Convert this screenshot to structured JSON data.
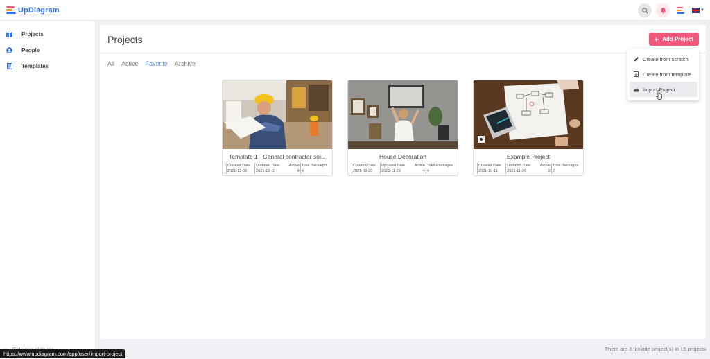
{
  "app": {
    "logo_text": "UpDiagram"
  },
  "header": {
    "icons": [
      "search-icon",
      "bell-icon",
      "menu-lines-icon",
      "uk-flag-icon"
    ]
  },
  "sidebar": {
    "items": [
      {
        "label": "Projects",
        "icon": "book-icon"
      },
      {
        "label": "People",
        "icon": "person-icon"
      },
      {
        "label": "Templates",
        "icon": "template-icon"
      }
    ],
    "collapse_label": "Collapse sidebar"
  },
  "main": {
    "title": "Projects",
    "add_button_label": "Add Project",
    "tabs": [
      {
        "label": "All",
        "active": false
      },
      {
        "label": "Active",
        "active": false
      },
      {
        "label": "Favorite",
        "active": true
      },
      {
        "label": "Archive",
        "active": false
      }
    ],
    "meta_headers": [
      "Created Date",
      "Updated Date",
      "Active",
      "Total Packages"
    ],
    "cards": [
      {
        "title": "Template 1 - General contractor sol...",
        "created": "2021-12-08",
        "updated": "2021-12-10",
        "active": "4",
        "total_packages": "4"
      },
      {
        "title": "House Decoration",
        "created": "2021-09-20",
        "updated": "2021-11-29",
        "active": "4",
        "total_packages": "4"
      },
      {
        "title": "Example Project",
        "created": "2021-10-11",
        "updated": "2021-11-26",
        "active": "2",
        "total_packages": "2"
      }
    ]
  },
  "dropdown": {
    "items": [
      {
        "label": "Create from scratch",
        "icon": "pencil-icon"
      },
      {
        "label": "Create from template",
        "icon": "document-icon"
      },
      {
        "label": "Import Project",
        "icon": "cloud-icon"
      }
    ]
  },
  "footer": {
    "summary": "There are 3 favorite project(s) in 15 projects"
  },
  "status_url": "https://www.updiagram.com/app/user/import-project",
  "colors": {
    "accent": "#f0587b",
    "brand_blue": "#2f6fed",
    "active_tab": "#5b8def"
  }
}
